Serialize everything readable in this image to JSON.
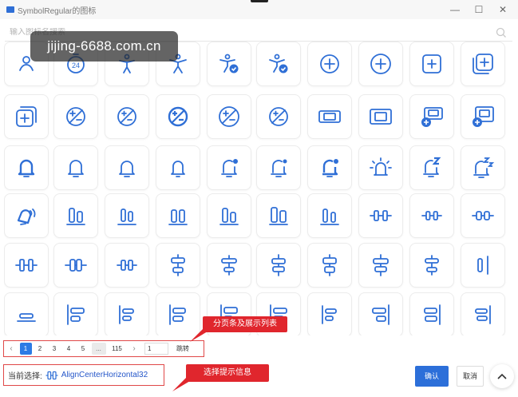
{
  "window": {
    "title": "SymbolRegular的图标",
    "controls": {
      "minimize": "—",
      "maximize": "☐",
      "close": "✕"
    }
  },
  "search": {
    "placeholder": "输入图标名搜索",
    "icon": "search-icon"
  },
  "watermark": "jijing-6688.com.cn",
  "colors": {
    "accent": "#2c6fd9",
    "icon_stroke": "#2f6fd6",
    "highlight": "#e0262d"
  },
  "icon_grid": {
    "rows": [
      [
        "people-partial",
        "timer-24",
        "accessibility",
        "accessibility-alt",
        "accessibility-checkmark",
        "accessibility-checkmark-alt",
        "add-circle",
        "add-circle-alt",
        "add-square",
        "add-square-multiple"
      ],
      [
        "add-square-multiple-alt",
        "add-subtract-circle",
        "add-subtract-circle-alt",
        "add-subtract-circle-bold",
        "add-subtract-circle-alt2",
        "add-subtract-circle-alt3",
        "album",
        "album-alt",
        "album-add",
        "album-add-alt"
      ],
      [
        "alert",
        "alert-alt",
        "alert-alt2",
        "alert-alt3",
        "alert-badge",
        "alert-badge-alt",
        "alert-badge-bold",
        "alert-urgent",
        "alert-snooze",
        "alert-snooze-alt"
      ],
      [
        "alert-on",
        "align-bottom",
        "align-bottom-alt",
        "align-bottom-alt2",
        "align-bottom-alt3",
        "align-bottom-alt4",
        "align-bottom-alt5",
        "align-center-horizontal",
        "align-center-horizontal-alt",
        "align-center-horizontal-alt2"
      ],
      [
        "align-center-horizontal-alt3",
        "align-center-horizontal-alt4",
        "align-center-horizontal-alt5",
        "align-center-vertical",
        "align-center-vertical-alt",
        "align-center-vertical-alt2",
        "align-center-vertical-alt3",
        "align-center-vertical-alt4",
        "align-center-vertical-alt5",
        "align-end-horizontal"
      ],
      [
        "align-end-vertical",
        "align-left",
        "align-left-alt",
        "align-left-alt2",
        "align-left-alt3",
        "align-left-alt4",
        "align-left-alt5",
        "align-right",
        "align-right-alt",
        "align-right-alt2"
      ]
    ]
  },
  "pagination": {
    "prev": "‹",
    "pages": [
      "1",
      "2",
      "3",
      "4",
      "5"
    ],
    "ellipsis": "...",
    "last": "115",
    "next": "›",
    "jump_value": "1",
    "jump_label": "跳转",
    "active_index": 0
  },
  "callouts": {
    "pagination": "分页条及展示列表",
    "selection": "选择提示信息"
  },
  "selection": {
    "label": "当前选择:",
    "name": "AlignCenterHorizontal32",
    "icon": "align-center-horizontal-icon"
  },
  "buttons": {
    "ok": "确认",
    "cancel": "取消",
    "scroll_top": "scroll-to-top-icon"
  }
}
